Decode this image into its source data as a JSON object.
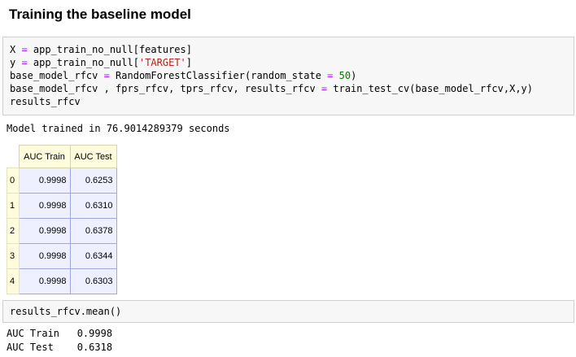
{
  "heading": "Training the baseline model",
  "cell1": {
    "lines": [
      [
        "X ",
        "=",
        " app_train_no_null[features]"
      ],
      [
        "y ",
        "=",
        " app_train_no_null[",
        "'TARGET'",
        "]"
      ],
      [
        "base_model_rfcv ",
        "=",
        " RandomForestClassifier(random_state ",
        "=",
        " ",
        "50",
        ")"
      ],
      [
        "base_model_rfcv , fprs_rfcv, tprs_rfcv, results_rfcv ",
        "=",
        " train_test_cv(base_model_rfcv,X,y)"
      ],
      [
        "results_rfcv"
      ]
    ]
  },
  "output1": {
    "message": "Model trained in 76.9014289379 seconds"
  },
  "table": {
    "columns": [
      "AUC Train",
      "AUC Test"
    ],
    "rows": [
      {
        "index": "0",
        "train": "0.9998",
        "test": "0.6253"
      },
      {
        "index": "1",
        "train": "0.9998",
        "test": "0.6310"
      },
      {
        "index": "2",
        "train": "0.9998",
        "test": "0.6378"
      },
      {
        "index": "3",
        "train": "0.9998",
        "test": "0.6344"
      },
      {
        "index": "4",
        "train": "0.9998",
        "test": "0.6303"
      }
    ]
  },
  "cell2": {
    "code": "results_rfcv.mean()"
  },
  "output2": {
    "lines": [
      "AUC Train   0.9998",
      "AUC Test    0.6318"
    ]
  }
}
